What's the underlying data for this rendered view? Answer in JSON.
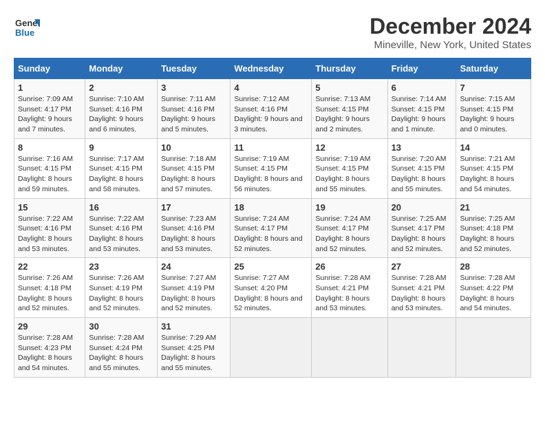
{
  "logo": {
    "line1": "General",
    "line2": "Blue"
  },
  "title": "December 2024",
  "subtitle": "Mineville, New York, United States",
  "days_of_week": [
    "Sunday",
    "Monday",
    "Tuesday",
    "Wednesday",
    "Thursday",
    "Friday",
    "Saturday"
  ],
  "weeks": [
    [
      {
        "day": "1",
        "sunrise": "7:09 AM",
        "sunset": "4:17 PM",
        "daylight": "9 hours and 7 minutes."
      },
      {
        "day": "2",
        "sunrise": "7:10 AM",
        "sunset": "4:16 PM",
        "daylight": "9 hours and 6 minutes."
      },
      {
        "day": "3",
        "sunrise": "7:11 AM",
        "sunset": "4:16 PM",
        "daylight": "9 hours and 5 minutes."
      },
      {
        "day": "4",
        "sunrise": "7:12 AM",
        "sunset": "4:16 PM",
        "daylight": "9 hours and 3 minutes."
      },
      {
        "day": "5",
        "sunrise": "7:13 AM",
        "sunset": "4:15 PM",
        "daylight": "9 hours and 2 minutes."
      },
      {
        "day": "6",
        "sunrise": "7:14 AM",
        "sunset": "4:15 PM",
        "daylight": "9 hours and 1 minute."
      },
      {
        "day": "7",
        "sunrise": "7:15 AM",
        "sunset": "4:15 PM",
        "daylight": "9 hours and 0 minutes."
      }
    ],
    [
      {
        "day": "8",
        "sunrise": "7:16 AM",
        "sunset": "4:15 PM",
        "daylight": "8 hours and 59 minutes."
      },
      {
        "day": "9",
        "sunrise": "7:17 AM",
        "sunset": "4:15 PM",
        "daylight": "8 hours and 58 minutes."
      },
      {
        "day": "10",
        "sunrise": "7:18 AM",
        "sunset": "4:15 PM",
        "daylight": "8 hours and 57 minutes."
      },
      {
        "day": "11",
        "sunrise": "7:19 AM",
        "sunset": "4:15 PM",
        "daylight": "8 hours and 56 minutes."
      },
      {
        "day": "12",
        "sunrise": "7:19 AM",
        "sunset": "4:15 PM",
        "daylight": "8 hours and 55 minutes."
      },
      {
        "day": "13",
        "sunrise": "7:20 AM",
        "sunset": "4:15 PM",
        "daylight": "8 hours and 55 minutes."
      },
      {
        "day": "14",
        "sunrise": "7:21 AM",
        "sunset": "4:15 PM",
        "daylight": "8 hours and 54 minutes."
      }
    ],
    [
      {
        "day": "15",
        "sunrise": "7:22 AM",
        "sunset": "4:16 PM",
        "daylight": "8 hours and 53 minutes."
      },
      {
        "day": "16",
        "sunrise": "7:22 AM",
        "sunset": "4:16 PM",
        "daylight": "8 hours and 53 minutes."
      },
      {
        "day": "17",
        "sunrise": "7:23 AM",
        "sunset": "4:16 PM",
        "daylight": "8 hours and 53 minutes."
      },
      {
        "day": "18",
        "sunrise": "7:24 AM",
        "sunset": "4:17 PM",
        "daylight": "8 hours and 52 minutes."
      },
      {
        "day": "19",
        "sunrise": "7:24 AM",
        "sunset": "4:17 PM",
        "daylight": "8 hours and 52 minutes."
      },
      {
        "day": "20",
        "sunrise": "7:25 AM",
        "sunset": "4:17 PM",
        "daylight": "8 hours and 52 minutes."
      },
      {
        "day": "21",
        "sunrise": "7:25 AM",
        "sunset": "4:18 PM",
        "daylight": "8 hours and 52 minutes."
      }
    ],
    [
      {
        "day": "22",
        "sunrise": "7:26 AM",
        "sunset": "4:18 PM",
        "daylight": "8 hours and 52 minutes."
      },
      {
        "day": "23",
        "sunrise": "7:26 AM",
        "sunset": "4:19 PM",
        "daylight": "8 hours and 52 minutes."
      },
      {
        "day": "24",
        "sunrise": "7:27 AM",
        "sunset": "4:19 PM",
        "daylight": "8 hours and 52 minutes."
      },
      {
        "day": "25",
        "sunrise": "7:27 AM",
        "sunset": "4:20 PM",
        "daylight": "8 hours and 52 minutes."
      },
      {
        "day": "26",
        "sunrise": "7:28 AM",
        "sunset": "4:21 PM",
        "daylight": "8 hours and 53 minutes."
      },
      {
        "day": "27",
        "sunrise": "7:28 AM",
        "sunset": "4:21 PM",
        "daylight": "8 hours and 53 minutes."
      },
      {
        "day": "28",
        "sunrise": "7:28 AM",
        "sunset": "4:22 PM",
        "daylight": "8 hours and 54 minutes."
      }
    ],
    [
      {
        "day": "29",
        "sunrise": "7:28 AM",
        "sunset": "4:23 PM",
        "daylight": "8 hours and 54 minutes."
      },
      {
        "day": "30",
        "sunrise": "7:28 AM",
        "sunset": "4:24 PM",
        "daylight": "8 hours and 55 minutes."
      },
      {
        "day": "31",
        "sunrise": "7:29 AM",
        "sunset": "4:25 PM",
        "daylight": "8 hours and 55 minutes."
      },
      null,
      null,
      null,
      null
    ]
  ]
}
